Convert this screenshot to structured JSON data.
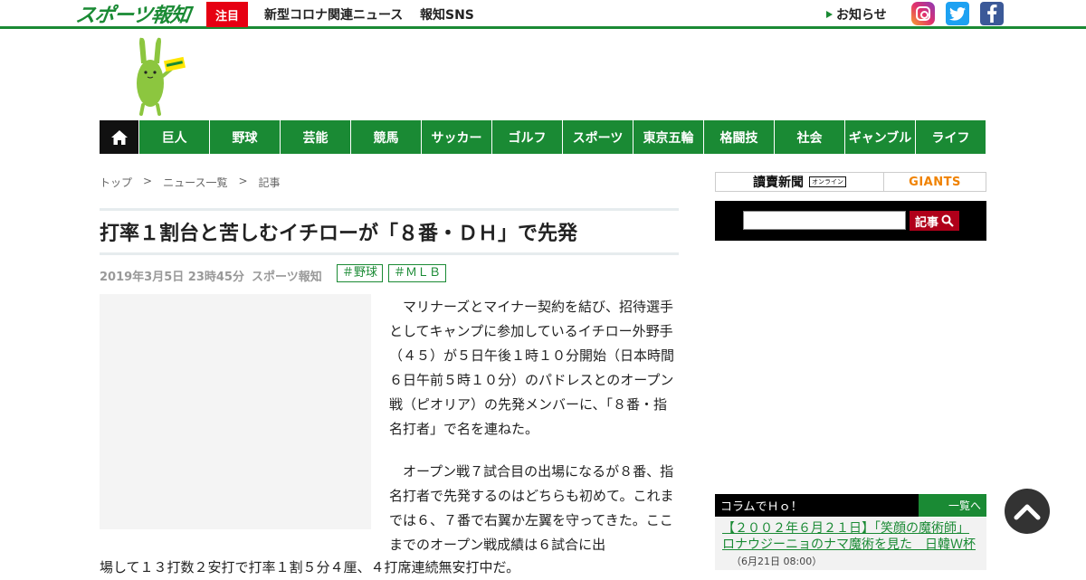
{
  "header": {
    "logo_text": "スポーツ報知",
    "chumoku_label": "注目",
    "links": [
      "新型コロナ関連ニュース",
      "報知SNS"
    ],
    "notice_label": "お知らせ",
    "sns_icons": [
      "instagram-icon",
      "twitter-icon",
      "facebook-icon"
    ]
  },
  "nav": {
    "home_icon": "home-icon",
    "items": [
      "巨人",
      "野球",
      "芸能",
      "競馬",
      "サッカー",
      "ゴルフ",
      "スポーツ",
      "東京五輪",
      "格闘技",
      "社会",
      "ギャンブル",
      "ライフ"
    ]
  },
  "breadcrumb": [
    "トップ",
    ">",
    "ニュース一覧",
    ">",
    "記事"
  ],
  "article": {
    "title": "打率１割台と苦しむイチローが「８番・ＤＨ」で先発",
    "date": "2019年3月5日 23時45分",
    "source": "スポーツ報知",
    "tags": [
      "＃野球",
      "＃ＭＬＢ"
    ],
    "paragraph1": "マリナーズとマイナー契約を結び、招待選手としてキャンプに参加しているイチロー外野手（４５）が５日午後１時１０分開始（日本時間６日午前５時１０分）のパドレスとのオープン戦（ピオリア）の先発メンバーに、「８番・指名打者」で名を連ねた。",
    "paragraph2": "オープン戦７試合目の出場になるが８番、指名打者で先発するのはどちらも初めて。これまでは６、７番で右翼か左翼を守ってきた。ここまでのオープン戦成績は６試合に出",
    "paragraph2_cont": "場して１３打数２安打で打率１割５分４厘、４打席連続無安打中だ。"
  },
  "sidebar": {
    "yomiuri_label": "讀賣新聞",
    "yomiuri_online": "オンライン",
    "giants_label": "GIANTS",
    "search_button": "記事",
    "column_title": "コラムでＨｏ！",
    "column_more": "一覧へ",
    "column_item_title": "【２００２年６月２１日】「笑顔の魔術師」ロナウジーニョのナマ魔術を見た　日韓Ｗ杯",
    "column_item_date": "（6月21日 08:00）"
  },
  "colors": {
    "brand_green": "#1a8a34",
    "alert_red": "#e60012",
    "giants_orange": "#f08200"
  }
}
